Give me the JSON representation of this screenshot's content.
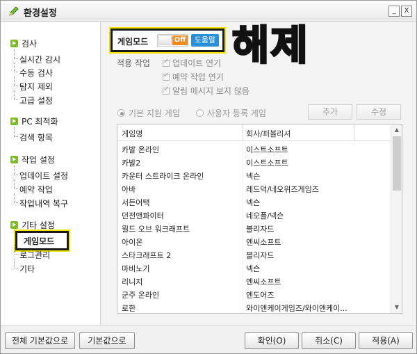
{
  "window": {
    "title": "환경설정",
    "minimize_glyph": "_",
    "close_glyph": "X"
  },
  "sidebar": {
    "groups": [
      {
        "label": "검사",
        "items": [
          "실시간 감시",
          "수동 검사",
          "탐지 제외",
          "고급 설정"
        ]
      },
      {
        "label": "PC 최적화",
        "items": [
          "검색 항목"
        ]
      },
      {
        "label": "작업 설정",
        "items": [
          "업데이트 설정",
          "예약 작업",
          "작업내역 복구"
        ]
      },
      {
        "label": "기타 설정",
        "items": [
          "게임모드",
          "로그관리",
          "기타"
        ]
      }
    ],
    "selected": "게임모드"
  },
  "game_mode": {
    "label": "게임모드",
    "toggle_state": "Off",
    "help_label": "도움말"
  },
  "annotation": "해제",
  "apply": {
    "label": "적용 작업",
    "options": [
      {
        "label": "업데이트 연기",
        "checked": true
      },
      {
        "label": "예약 작업 연기",
        "checked": true
      },
      {
        "label": "알림 메시지 보지 않음",
        "checked": true
      }
    ]
  },
  "game_source": {
    "options": [
      {
        "label": "기본 지원 게임",
        "selected": true
      },
      {
        "label": "사용자 등록 게임",
        "selected": false
      }
    ],
    "add_label": "추가",
    "edit_label": "수정"
  },
  "table": {
    "columns": [
      "게임명",
      "회사/퍼블리셔"
    ],
    "rows": [
      [
        "카발 온라인",
        "이스트소프트"
      ],
      [
        "카발2",
        "이스트소프트"
      ],
      [
        "카운터 스트라이크 온라인",
        "넥슨"
      ],
      [
        "아바",
        "레드덕/네오위즈게임즈"
      ],
      [
        "서든어택",
        "넥슨"
      ],
      [
        "던전앤파이터",
        "네오플/넥슨"
      ],
      [
        "월드 오브 워크래프트",
        "블리자드"
      ],
      [
        "아이온",
        "엔씨소프트"
      ],
      [
        "스타크래프트 2",
        "블리자드"
      ],
      [
        "마비노기",
        "넥슨"
      ],
      [
        "리니지",
        "엔씨소프트"
      ],
      [
        "군주 온라인",
        "엔도어즈"
      ],
      [
        "로한",
        "와이앤케이게임즈/와이앤케이..."
      ]
    ]
  },
  "footer": {
    "reset_all_label": "전체 기본값으로",
    "reset_label": "기본값으로",
    "ok_label": "확인(O)",
    "cancel_label": "취소(C)",
    "apply_label": "적용(A)"
  },
  "colors": {
    "accent_yellow": "#f5e600",
    "toggle_off": "#f08a22",
    "help_blue": "#2a8fd8",
    "group_green": "#7dbb2a"
  }
}
